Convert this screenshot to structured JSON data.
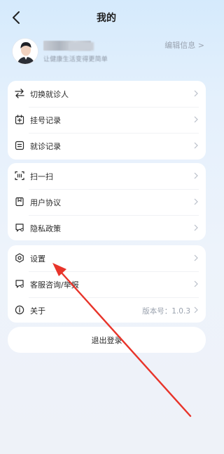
{
  "header": {
    "title": "我的",
    "back_icon": "back-arrow-icon"
  },
  "profile": {
    "subtitle": "让健康生活变得更简单",
    "edit_label": "编辑信息",
    "edit_chevron": ">"
  },
  "group1": [
    {
      "label": "切换就诊人",
      "icon": "swap-icon"
    },
    {
      "label": "挂号记录",
      "icon": "calendar-plus-icon"
    },
    {
      "label": "就诊记录",
      "icon": "document-icon"
    }
  ],
  "group2": [
    {
      "label": "扫一扫",
      "icon": "scan-icon"
    },
    {
      "label": "用户协议",
      "icon": "bookmark-icon"
    },
    {
      "label": "隐私政策",
      "icon": "privacy-chat-icon"
    }
  ],
  "group3": [
    {
      "label": "设置",
      "icon": "settings-icon"
    },
    {
      "label": "客服咨询/举报",
      "icon": "service-chat-icon"
    },
    {
      "label": "关于",
      "icon": "info-icon",
      "value": "版本号：1.0.3"
    }
  ],
  "logout_label": "退出登录",
  "colors": {
    "annotation_arrow": "#e8342a"
  }
}
